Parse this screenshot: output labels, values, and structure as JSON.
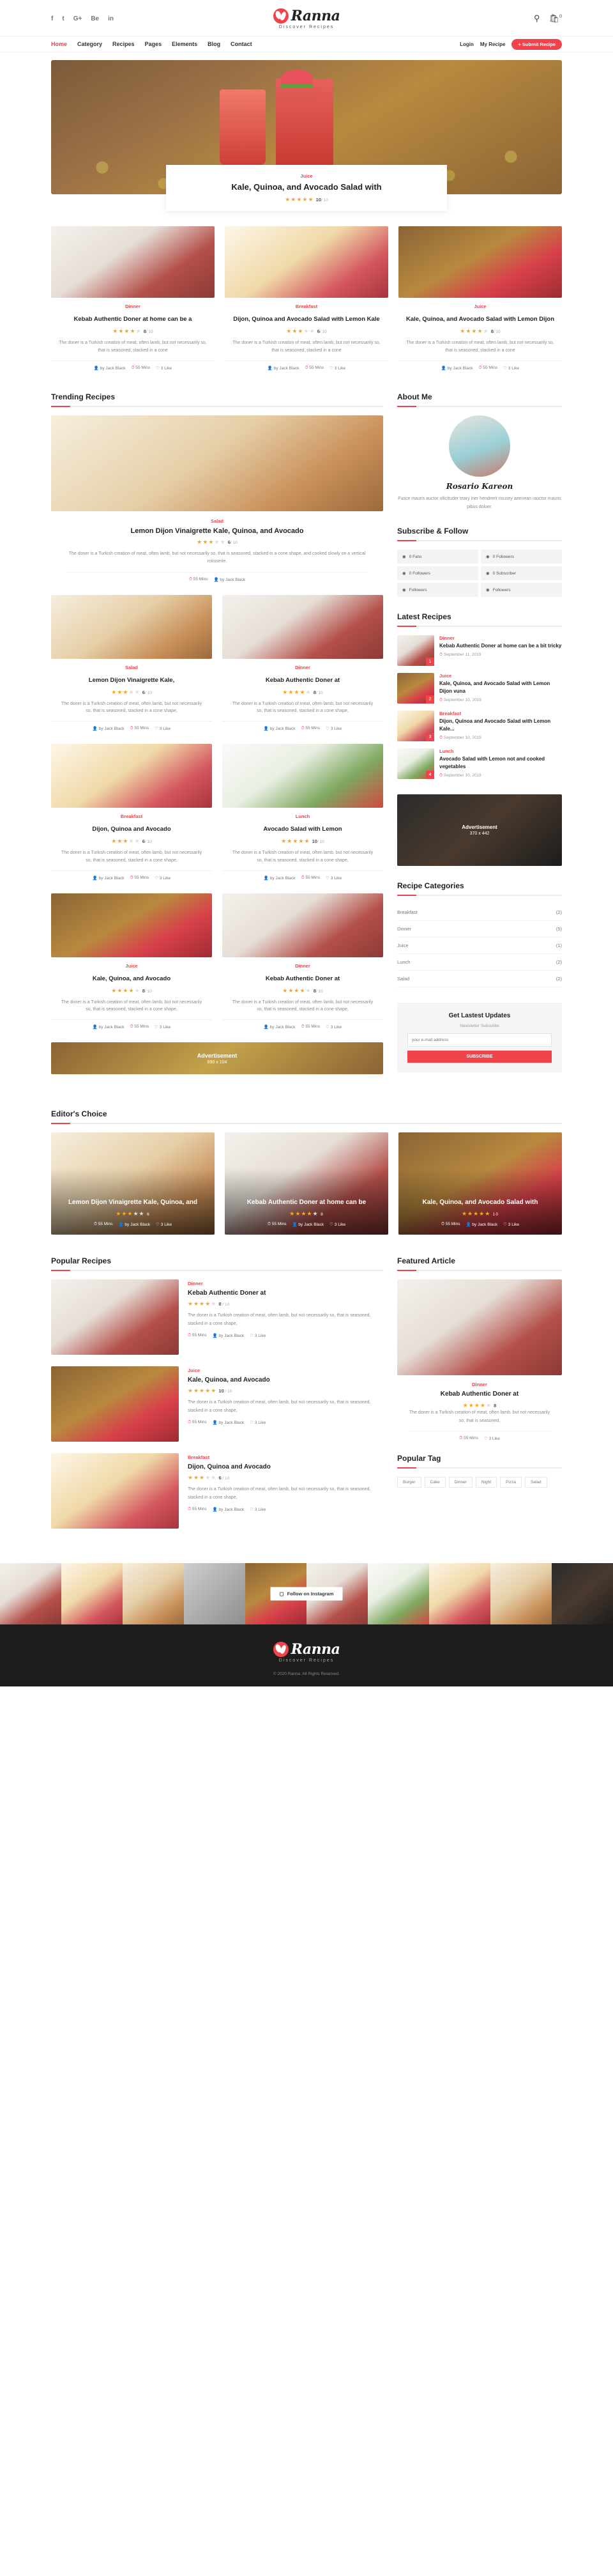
{
  "topbar": {
    "social": [
      "f",
      "t",
      "G+",
      "Be",
      "in"
    ],
    "social_names": [
      "facebook",
      "twitter",
      "google-plus",
      "behance",
      "linkedin"
    ],
    "logo": "Ranna",
    "tagline": "Discover Recipes",
    "search_icon": "search-icon",
    "cart_icon": "cart-icon",
    "cart_count": "0"
  },
  "nav": {
    "items": [
      "Home",
      "Category",
      "Recipes",
      "Pages",
      "Elements",
      "Blog",
      "Contact"
    ],
    "active": "Home",
    "login": "Login",
    "my_recipe": "My Recipe",
    "submit": "+ Submit Recipe"
  },
  "hero": {
    "category": "Juice",
    "title": "Kale, Quinoa, and Avocado Salad with",
    "rating": "10",
    "rating_max": "/ 10",
    "stars_on": 5
  },
  "top_cards": [
    {
      "category": "Dinner",
      "title": "Kebab Authentic Doner at home can be a",
      "rating": "8",
      "rating_max": "/ 10",
      "stars_on": 4,
      "desc": "The doner is a Turkish creation of meat, often lamb, but not necessarily so, that is seasoned, stacked in a cone",
      "author": "by Jack Black",
      "time": "55 Mins",
      "likes": "3 Like",
      "tex": "t-pie"
    },
    {
      "category": "Breakfast",
      "title": "Dijon, Quinoa and Avocado Salad with Lemon Kale",
      "rating": "6",
      "rating_max": "/ 10",
      "stars_on": 3,
      "desc": "The doner is a Turkish creation of meat, often lamb, but not necessarily so, that is seasoned, stacked in a cone",
      "author": "by Jack Black",
      "time": "55 Mins",
      "likes": "3 Like",
      "tex": "t-waffle"
    },
    {
      "category": "Juice",
      "title": "Kale, Quinoa, and Avocado Salad with Lemon Dijon",
      "rating": "8",
      "rating_max": "/ 10",
      "stars_on": 4,
      "desc": "The doner is a Turkish creation of meat, often lamb, but not necessarily so, that is seasoned, stacked in a cone",
      "author": "by Jack Black",
      "time": "55 Mins",
      "likes": "3 Like",
      "tex": "t-juice"
    }
  ],
  "trending": {
    "heading": "Trending Recipes",
    "feature": {
      "category": "Salad",
      "title": "Lemon Dijon Vinaigrette Kale, Quinoa, and Avocado",
      "rating": "6",
      "rating_max": "/ 10",
      "stars_on": 3,
      "desc": "The doner is a Turkish creation of meat, often lamb, but not necessarily so, that is seasoned, stacked in a cone shape, and cooked slowly on a vertical rotisserie.",
      "time": "55 Mins",
      "author": "by Jack Black",
      "tex": "t-cookie"
    },
    "cards": [
      {
        "category": "Salad",
        "title": "Lemon Dijon Vinaigrette Kale,",
        "rating": "6",
        "rating_max": "/ 10",
        "stars_on": 3,
        "desc": "The doner is a Turkish creation of meat, often lamb, but not necessarily so, that is seasoned, stacked in a cone shape,",
        "author": "by Jack Black",
        "time": "55 Mins",
        "likes": "3 Like",
        "tex": "t-cookie"
      },
      {
        "category": "Dinner",
        "title": "Kebab Authentic Doner at",
        "rating": "8",
        "rating_max": "/ 10",
        "stars_on": 4,
        "desc": "The doner is a Turkish creation of meat, often lamb, but not necessarily so, that is seasoned, stacked in a cone shape,",
        "author": "by Jack Black",
        "time": "55 Mins",
        "likes": "3 Like",
        "tex": "t-pie"
      },
      {
        "category": "Breakfast",
        "title": "Dijon, Quinoa and Avocado",
        "rating": "6",
        "rating_max": "/ 10",
        "stars_on": 3,
        "desc": "The doner is a Turkish creation of meat, often lamb, but not necessarily so, that is seasoned, stacked in a cone shape,",
        "author": "by Jack Black",
        "time": "55 Mins",
        "likes": "3 Like",
        "tex": "t-waffle"
      },
      {
        "category": "Lunch",
        "title": "Avocado Salad with Lemon",
        "rating": "10",
        "rating_max": "/ 10",
        "stars_on": 5,
        "desc": "The doner is a Turkish creation of meat, often lamb, but not necessarily so, that is seasoned, stacked in a cone shape,",
        "author": "by Jack Black",
        "time": "55 Mins",
        "likes": "3 Like",
        "tex": "t-salad"
      },
      {
        "category": "Juice",
        "title": "Kale, Quinoa, and Avocado",
        "rating": "8",
        "rating_max": "/ 10",
        "stars_on": 4,
        "desc": "The doner is a Turkish creation of meat, often lamb, but not necessarily so, that is seasoned, stacked in a cone shape,",
        "author": "by Jack Black",
        "time": "55 Mins",
        "likes": "3 Like",
        "tex": "t-juice"
      },
      {
        "category": "Dinner",
        "title": "Kebab Authentic Doner at",
        "rating": "8",
        "rating_max": "/ 10",
        "stars_on": 4,
        "desc": "The doner is a Turkish creation of meat, often lamb, but not necessarily so, that is seasoned, stacked in a cone shape,",
        "author": "by Jack Black",
        "time": "55 Mins",
        "likes": "3 Like",
        "tex": "t-pie"
      }
    ],
    "ad": {
      "label": "Advertisement",
      "size": "690 x 104"
    }
  },
  "sidebar": {
    "about": {
      "heading": "About Me",
      "name": "Rosario Kareon",
      "text": "Fusce mauris auctor ollicituder teary iner hendrerit risusey aeenean rauctor mauris pibus doloer."
    },
    "follow": {
      "heading": "Subscribe & Follow",
      "items": [
        {
          "icon": "facebook-icon",
          "count": "0",
          "label": "Fans"
        },
        {
          "icon": "twitter-icon",
          "count": "0",
          "label": "Followers"
        },
        {
          "icon": "instagram-icon",
          "count": "0",
          "label": "Followers"
        },
        {
          "icon": "youtube-icon",
          "count": "0",
          "label": "Subscriber"
        },
        {
          "icon": "soundcloud-icon",
          "count": "",
          "label": "Followers"
        },
        {
          "icon": "dribbble-icon",
          "count": "",
          "label": "Followers"
        }
      ]
    },
    "latest": {
      "heading": "Latest Recipes",
      "items": [
        {
          "num": "1",
          "category": "Dinner",
          "title": "Kebab Authentic Doner at home can be a bit tricky",
          "date": "September 11, 2019",
          "tex": "t-pie"
        },
        {
          "num": "2",
          "category": "Juice",
          "title": "Kale, Quinoa, and Avocado Salad with Lemon Dijon vuna",
          "date": "September 10, 2019",
          "tex": "t-juice"
        },
        {
          "num": "3",
          "category": "Breakfast",
          "title": "Dijon, Quinoa and Avocado Salad with Lemon Kale...",
          "date": "September 10, 2019",
          "tex": "t-waffle"
        },
        {
          "num": "4",
          "category": "Lunch",
          "title": "Avocado Salad with Lemon not and cooked vegetables",
          "date": "September 10, 2019",
          "tex": "t-salad"
        }
      ]
    },
    "ad": {
      "label": "Advertisement",
      "size": "370 x 442"
    },
    "categories": {
      "heading": "Recipe Categories",
      "items": [
        {
          "name": "Breakfast",
          "count": "(2)"
        },
        {
          "name": "Dinner",
          "count": "(5)"
        },
        {
          "name": "Juice",
          "count": "(1)"
        },
        {
          "name": "Lunch",
          "count": "(2)"
        },
        {
          "name": "Salad",
          "count": "(2)"
        }
      ]
    },
    "newsletter": {
      "heading": "Get Lastest Updates",
      "sub": "Newsletter Subscribe",
      "placeholder": "your e-mail address",
      "button": "SUBSCRIBE"
    }
  },
  "editors": {
    "heading": "Editor's Choice",
    "cards": [
      {
        "title": "Lemon Dijon Vinaigrette Kale, Quinoa, and",
        "rating": "6",
        "stars_on": 3,
        "time": "55 Mins",
        "author": "by Jack Black",
        "likes": "3 Like",
        "tex": "t-cookie"
      },
      {
        "title": "Kebab Authentic Doner at home can be",
        "rating": "8",
        "stars_on": 4,
        "time": "55 Mins",
        "author": "by Jack Black",
        "likes": "3 Like",
        "tex": "t-pie"
      },
      {
        "title": "Kale, Quinoa, and Avocado Salad with",
        "rating": "10",
        "stars_on": 5,
        "time": "55 Mins",
        "author": "by Jack Black",
        "likes": "3 Like",
        "tex": "t-juice"
      }
    ]
  },
  "popular": {
    "heading": "Popular Recipes",
    "items": [
      {
        "category": "Dinner",
        "title": "Kebab Authentic Doner at",
        "rating": "8",
        "stars_on": 4,
        "desc": "The doner is a Turkish creation of meat, often lamb, but not necessarily so, that is seasoned, stacked in a cone shape,",
        "time": "55 Mins",
        "author": "by Jack Black",
        "likes": "3 Like",
        "tex": "t-pie"
      },
      {
        "category": "Juice",
        "title": "Kale, Quinoa, and Avocado",
        "rating": "10",
        "stars_on": 5,
        "desc": "The doner is a Turkish creation of meat, often lamb, but not necessarily so, that is seasoned, stacked in a cone shape,",
        "time": "55 Mins",
        "author": "by Jack Black",
        "likes": "3 Like",
        "tex": "t-juice"
      },
      {
        "category": "Breakfast",
        "title": "Dijon, Quinoa and Avocado",
        "rating": "6",
        "stars_on": 3,
        "desc": "The doner is a Turkish creation of meat, often lamb, but not necessarily so, that is seasoned, stacked in a cone shape,",
        "time": "55 Mins",
        "author": "by Jack Black",
        "likes": "3 Like",
        "tex": "t-waffle"
      }
    ]
  },
  "featured": {
    "heading": "Featured Article",
    "category": "Dinner",
    "title": "Kebab Authentic Doner at",
    "rating": "8",
    "stars_on": 4,
    "desc": "The doner is a Turkish creation of meat, often lamb, but not necessarily so, that is seasoned,",
    "time": "55 Mins",
    "likes": "3 Like",
    "tex": "t-pie",
    "tag_heading": "Popular Tag",
    "tags": [
      "Burger",
      "Cake",
      "Dinner",
      "Night",
      "Pizza",
      "Salad"
    ]
  },
  "instagram": {
    "button": "Follow on Instagram",
    "icon": "instagram-icon"
  },
  "footer": {
    "logo": "Ranna",
    "tagline": "Discover Recipes",
    "copyright": "© 2020 Ranna. All Rights Reserved."
  }
}
